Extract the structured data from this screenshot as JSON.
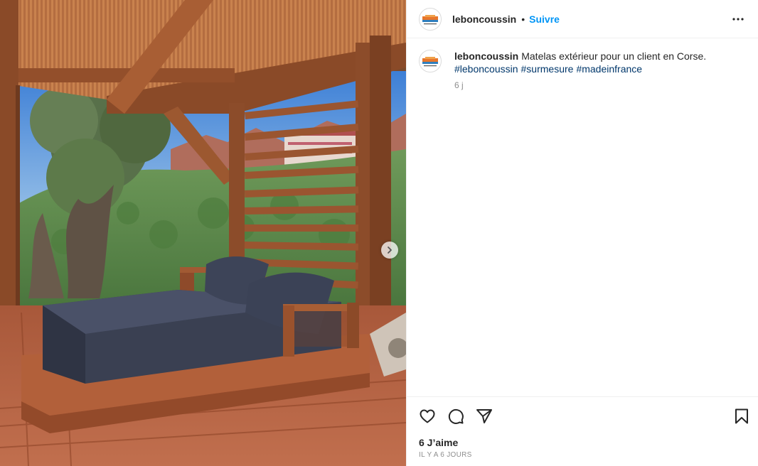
{
  "post": {
    "username": "leboncoussin",
    "follow_label": "Suivre",
    "separator": "•",
    "caption": {
      "username": "leboncoussin",
      "text": "Matelas extérieur pour un client en Corse.",
      "hashtags": [
        "#leboncoussin",
        "#surmesure",
        "#madeinfrance"
      ],
      "time_ago": "6 j"
    },
    "likes_label": "6 J’aime",
    "timestamp_label": "IL Y A 6 JOURS",
    "icons": {
      "like": "heart-icon",
      "comment": "comment-bubble-icon",
      "share": "paper-plane-icon",
      "save": "bookmark-icon",
      "more": "more-horizontal-icon",
      "next": "chevron-right-icon"
    },
    "colors": {
      "follow": "#0095f6",
      "hashtag": "#00376b",
      "text": "#262626",
      "secondary": "#8e8e8e",
      "border": "#efefef"
    }
  }
}
